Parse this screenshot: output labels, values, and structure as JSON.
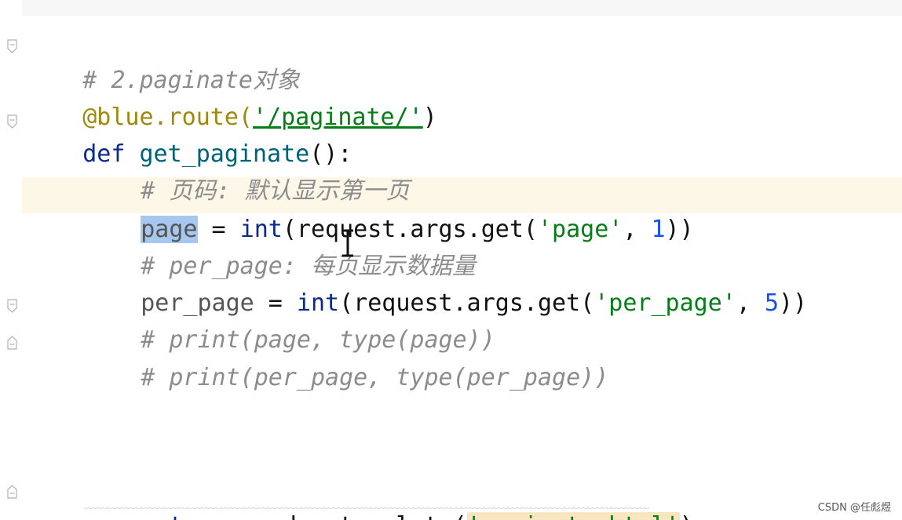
{
  "editor": {
    "colors": {
      "comment": "#8c8c8c",
      "keyword": "#0b2a8a",
      "decorator": "#9e880d",
      "string": "#067d17",
      "number": "#1750eb",
      "current_line": "#fcf7e6",
      "selection": "#a6c8f0"
    },
    "lines": {
      "l1_comment": "# 2.paginate对象",
      "l2_decorator": "@blue.route(",
      "l2_string": "'/paginate/'",
      "l2_close": ")",
      "l3_def": "def",
      "l3_funcname": "get_paginate",
      "l3_rest": "():",
      "l4_comment": "# 页码: 默认显示第一页",
      "l5_var": "page",
      "l5_eq": " = ",
      "l5_int": "int",
      "l5_call": "(request.args.get(",
      "l5_str": "'page'",
      "l5_comma": ", ",
      "l5_num": "1",
      "l5_close": "))",
      "l6_comment": "# per_page: 每页显示数据量",
      "l7_var": "per_page",
      "l7_eq": " = ",
      "l7_int": "int",
      "l7_call": "(request.args.get(",
      "l7_str": "'per_page'",
      "l7_comma": ", ",
      "l7_num": "5",
      "l7_close": "))",
      "l8_comment": "# print(page, type(page))",
      "l9_comment": "# print(per_page, type(per_page))",
      "l10_return": "return",
      "l10_call": " render_template(",
      "l10_str": "'paginate.html'",
      "l10_close": ")"
    }
  },
  "watermark": "CSDN @任彪煜"
}
